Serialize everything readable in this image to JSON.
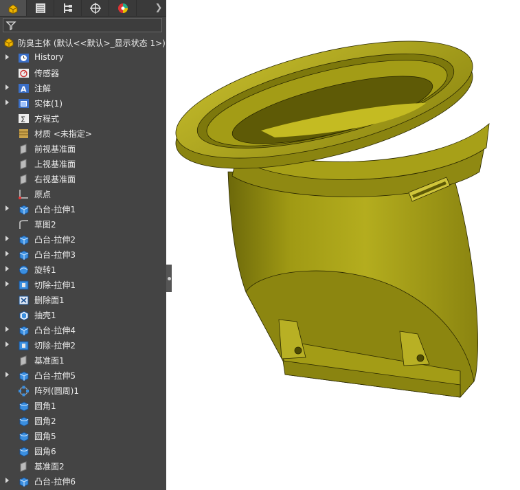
{
  "root_label": "防臭主体  (默认<<默认>_显示状态 1>)",
  "tree_items": [
    {
      "label": "History",
      "icon": "history-icon",
      "expand": true
    },
    {
      "label": "传感器",
      "icon": "sensor-icon",
      "expand": false
    },
    {
      "label": "注解",
      "icon": "annotation-icon",
      "expand": true
    },
    {
      "label": "实体(1)",
      "icon": "solid-bodies-icon",
      "expand": true
    },
    {
      "label": "方程式",
      "icon": "equations-icon",
      "expand": false
    },
    {
      "label": "材质 <未指定>",
      "icon": "material-icon",
      "expand": false
    },
    {
      "label": "前视基准面",
      "icon": "plane-icon",
      "expand": false
    },
    {
      "label": "上视基准面",
      "icon": "plane-icon",
      "expand": false
    },
    {
      "label": "右视基准面",
      "icon": "plane-icon",
      "expand": false
    },
    {
      "label": "原点",
      "icon": "origin-icon",
      "expand": false
    },
    {
      "label": "凸台-拉伸1",
      "icon": "extrude-icon",
      "expand": true
    },
    {
      "label": "草图2",
      "icon": "sketch-icon",
      "expand": false
    },
    {
      "label": "凸台-拉伸2",
      "icon": "extrude-icon",
      "expand": true
    },
    {
      "label": "凸台-拉伸3",
      "icon": "extrude-icon",
      "expand": true
    },
    {
      "label": "旋转1",
      "icon": "revolve-icon",
      "expand": true
    },
    {
      "label": "切除-拉伸1",
      "icon": "cut-extrude-icon",
      "expand": true
    },
    {
      "label": "删除面1",
      "icon": "delete-face-icon",
      "expand": false
    },
    {
      "label": "抽壳1",
      "icon": "shell-icon",
      "expand": false
    },
    {
      "label": "凸台-拉伸4",
      "icon": "extrude-icon",
      "expand": true
    },
    {
      "label": "切除-拉伸2",
      "icon": "cut-extrude-icon",
      "expand": true
    },
    {
      "label": "基准面1",
      "icon": "plane-icon",
      "expand": false
    },
    {
      "label": "凸台-拉伸5",
      "icon": "extrude-icon",
      "expand": true
    },
    {
      "label": "阵列(圆周)1",
      "icon": "circular-pattern-icon",
      "expand": false
    },
    {
      "label": "圆角1",
      "icon": "fillet-icon",
      "expand": false
    },
    {
      "label": "圆角2",
      "icon": "fillet-icon",
      "expand": false
    },
    {
      "label": "圆角5",
      "icon": "fillet-icon",
      "expand": false
    },
    {
      "label": "圆角6",
      "icon": "fillet-icon",
      "expand": false
    },
    {
      "label": "基准面2",
      "icon": "plane-icon",
      "expand": false
    },
    {
      "label": "凸台-拉伸6",
      "icon": "extrude-icon",
      "expand": true
    }
  ],
  "colors": {
    "panel": "#444444",
    "model": "#a8a015",
    "model_dark": "#6e6a0a"
  }
}
